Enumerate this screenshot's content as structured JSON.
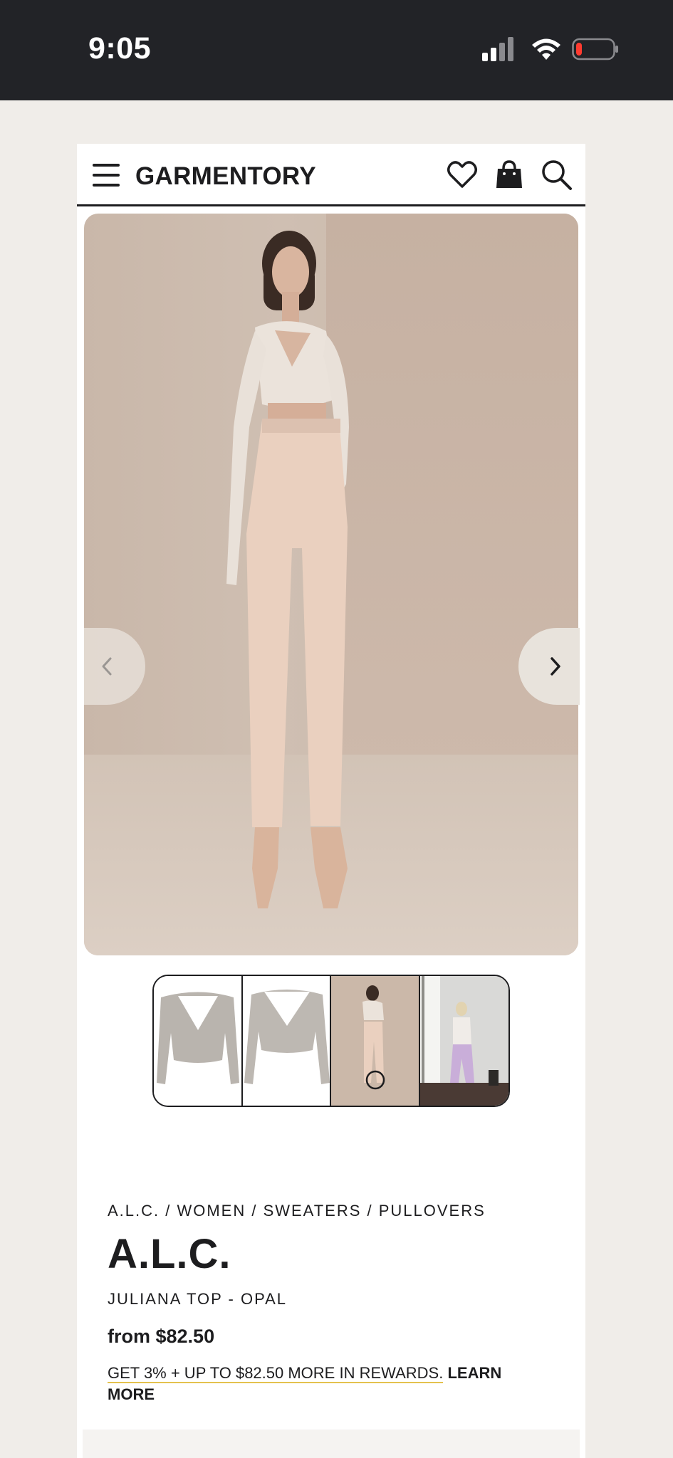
{
  "status_bar": {
    "time": "9:05"
  },
  "header": {
    "logo": "GARMENTORY"
  },
  "icons": {
    "menu": "hamburger-menu-icon",
    "wishlist": "heart-icon",
    "bag": "shopping-bag-icon",
    "search": "search-icon",
    "prev": "chevron-left-icon",
    "next": "chevron-right-icon"
  },
  "product": {
    "breadcrumb": "A.L.C. / WOMEN / SWEATERS / PULLOVERS",
    "brand": "A.L.C.",
    "name": "JULIANA TOP - OPAL",
    "price": "from $82.50",
    "rewards_text": "GET 3% + UP TO $82.50 MORE IN REWARDS.",
    "rewards_link": "LEARN MORE"
  },
  "gallery": {
    "thumbnail_count": 4,
    "selected_index": 2
  },
  "colors": {
    "status_bar_bg": "#222327",
    "page_bg": "#f0ede9",
    "text": "#1d1d1f",
    "accent_underline": "#e4c24e"
  }
}
